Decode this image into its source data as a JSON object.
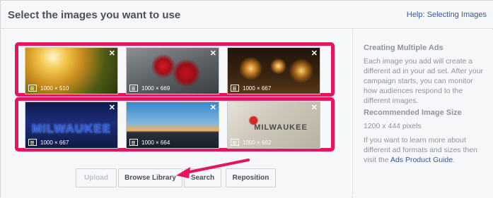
{
  "header": {
    "title": "Select the images you want to use",
    "help_link": "Help: Selecting Images"
  },
  "images": [
    {
      "dimensions": "1000 × 510",
      "close": "✕"
    },
    {
      "dimensions": "1000 × 669",
      "close": "✕"
    },
    {
      "dimensions": "1000 × 667",
      "close": "✕"
    },
    {
      "dimensions": "1000 × 667",
      "close": "✕",
      "overlay": "MILWAUKEE"
    },
    {
      "dimensions": "1000 × 664",
      "close": "✕"
    },
    {
      "dimensions": "1000 × 662",
      "close": "✕",
      "overlay": "MILWAUKEE"
    }
  ],
  "buttons": {
    "upload": "Upload",
    "browse_library": "Browse Library",
    "search": "Search",
    "reposition": "Reposition"
  },
  "sidebar": {
    "multiple_heading": "Creating Multiple Ads",
    "multiple_text": "Each image you add will create a different ad in your ad set. After your campaign starts, you can monitor how audiences respond to the different images.",
    "size_heading": "Recommended Image Size",
    "size_value": "1200 x 444 pixels",
    "learn_text": "If you want to learn more about different ad formats and sizes then visit the",
    "learn_link": "Ads Product Guide",
    "learn_end": "."
  },
  "colors": {
    "highlight": "#e5155d",
    "link": "#365899"
  }
}
